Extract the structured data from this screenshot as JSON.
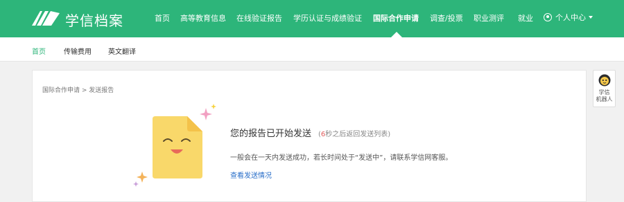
{
  "header": {
    "brand": "学信档案",
    "nav": [
      {
        "label": "首页"
      },
      {
        "label": "高等教育信息"
      },
      {
        "label": "在线验证报告"
      },
      {
        "label": "学历认证与成绩验证"
      },
      {
        "label": "国际合作申请",
        "active": true
      },
      {
        "label": "调查/投票"
      },
      {
        "label": "职业测评"
      },
      {
        "label": "就业"
      }
    ],
    "user_menu": "个人中心"
  },
  "subnav": {
    "items": [
      {
        "label": "首页",
        "active": true
      },
      {
        "label": "传输费用"
      },
      {
        "label": "英文翻译"
      }
    ]
  },
  "breadcrumb": "国际合作申请 > 发送报告",
  "message": {
    "title": "您的报告已开始发送",
    "countdown_prefix": "(",
    "countdown_number": "6",
    "countdown_suffix": "秒之后返回发送列表)",
    "description": "一般会在一天内发送成功，若长时间处于“发送中”，请联系学信网客服。",
    "link": "查看发送情况"
  },
  "robot": {
    "label_line1": "学信",
    "label_line2": "机器人"
  },
  "colors": {
    "brand_green": "#2db57a",
    "link_blue": "#2a6fc9",
    "countdown_red": "#e05a5a"
  }
}
